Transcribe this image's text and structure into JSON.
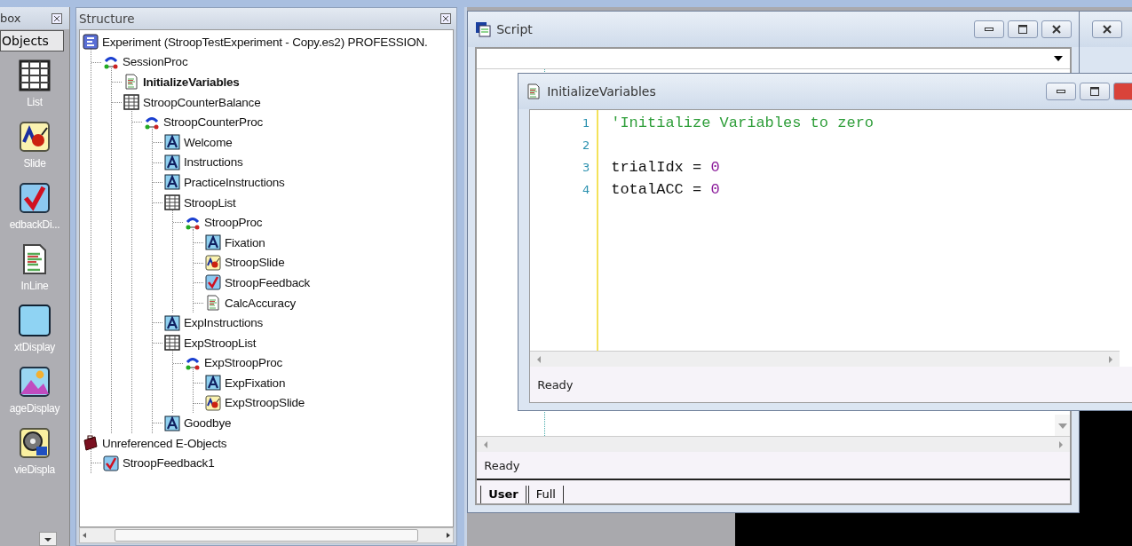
{
  "toolbox": {
    "title": "box",
    "tab": "Objects",
    "items": [
      {
        "label": "List",
        "kind": "list"
      },
      {
        "label": "Slide",
        "kind": "slide"
      },
      {
        "label": "edbackDi...",
        "kind": "feedback"
      },
      {
        "label": "InLine",
        "kind": "inline"
      },
      {
        "label": "xtDisplay",
        "kind": "text"
      },
      {
        "label": "ageDisplay",
        "kind": "image"
      },
      {
        "label": "vieDispla",
        "kind": "movie"
      }
    ]
  },
  "structure": {
    "title": "Structure",
    "tree": [
      {
        "label": "Experiment (StroopTestExperiment - Copy.es2) PROFESSION.",
        "kind": "experiment",
        "selected": false,
        "children": [
          {
            "label": "SessionProc",
            "kind": "procedure",
            "selected": false,
            "children": [
              {
                "label": "InitializeVariables",
                "kind": "inline",
                "selected": true
              },
              {
                "label": "StroopCounterBalance",
                "kind": "list",
                "selected": false,
                "children": [
                  {
                    "label": "StroopCounterProc",
                    "kind": "procedure",
                    "selected": false,
                    "children": [
                      {
                        "label": "Welcome",
                        "kind": "text",
                        "selected": false
                      },
                      {
                        "label": "Instructions",
                        "kind": "text",
                        "selected": false
                      },
                      {
                        "label": "PracticeInstructions",
                        "kind": "text",
                        "selected": false
                      },
                      {
                        "label": "StroopList",
                        "kind": "list",
                        "selected": false,
                        "children": [
                          {
                            "label": "StroopProc",
                            "kind": "procedure",
                            "selected": false,
                            "children": [
                              {
                                "label": "Fixation",
                                "kind": "text",
                                "selected": false
                              },
                              {
                                "label": "StroopSlide",
                                "kind": "slide",
                                "selected": false
                              },
                              {
                                "label": "StroopFeedback",
                                "kind": "feedback",
                                "selected": false
                              },
                              {
                                "label": "CalcAccuracy",
                                "kind": "inline",
                                "selected": false
                              }
                            ]
                          }
                        ]
                      },
                      {
                        "label": "ExpInstructions",
                        "kind": "text",
                        "selected": false
                      },
                      {
                        "label": "ExpStroopList",
                        "kind": "list",
                        "selected": false,
                        "children": [
                          {
                            "label": "ExpStroopProc",
                            "kind": "procedure",
                            "selected": false,
                            "children": [
                              {
                                "label": "ExpFixation",
                                "kind": "text",
                                "selected": false
                              },
                              {
                                "label": "ExpStroopSlide",
                                "kind": "slide",
                                "selected": false
                              }
                            ]
                          }
                        ]
                      },
                      {
                        "label": "Goodbye",
                        "kind": "text",
                        "selected": false
                      }
                    ]
                  }
                ]
              }
            ]
          }
        ]
      },
      {
        "label": "Unreferenced E-Objects",
        "kind": "unreferenced",
        "selected": false,
        "children": [
          {
            "label": "StroopFeedback1",
            "kind": "feedback",
            "selected": false
          }
        ]
      }
    ]
  },
  "script_window": {
    "title": "Script",
    "status": "Ready",
    "tabs": [
      {
        "label": "User",
        "selected": true
      },
      {
        "label": "Full",
        "selected": false
      }
    ]
  },
  "editor_window": {
    "title": "InitializeVariables",
    "status": "Ready",
    "lines": [
      {
        "number": "1",
        "tokens": [
          {
            "kind": "comment",
            "text": "'Initialize Variables to zero"
          }
        ]
      },
      {
        "number": "2"
      },
      {
        "number": "3",
        "tokens": [
          {
            "kind": "code",
            "text": "trialIdx = "
          },
          {
            "kind": "number",
            "text": "0"
          }
        ]
      },
      {
        "number": "4",
        "tokens": [
          {
            "kind": "code",
            "text": "totalACC = "
          },
          {
            "kind": "number",
            "text": "0"
          }
        ]
      }
    ]
  }
}
